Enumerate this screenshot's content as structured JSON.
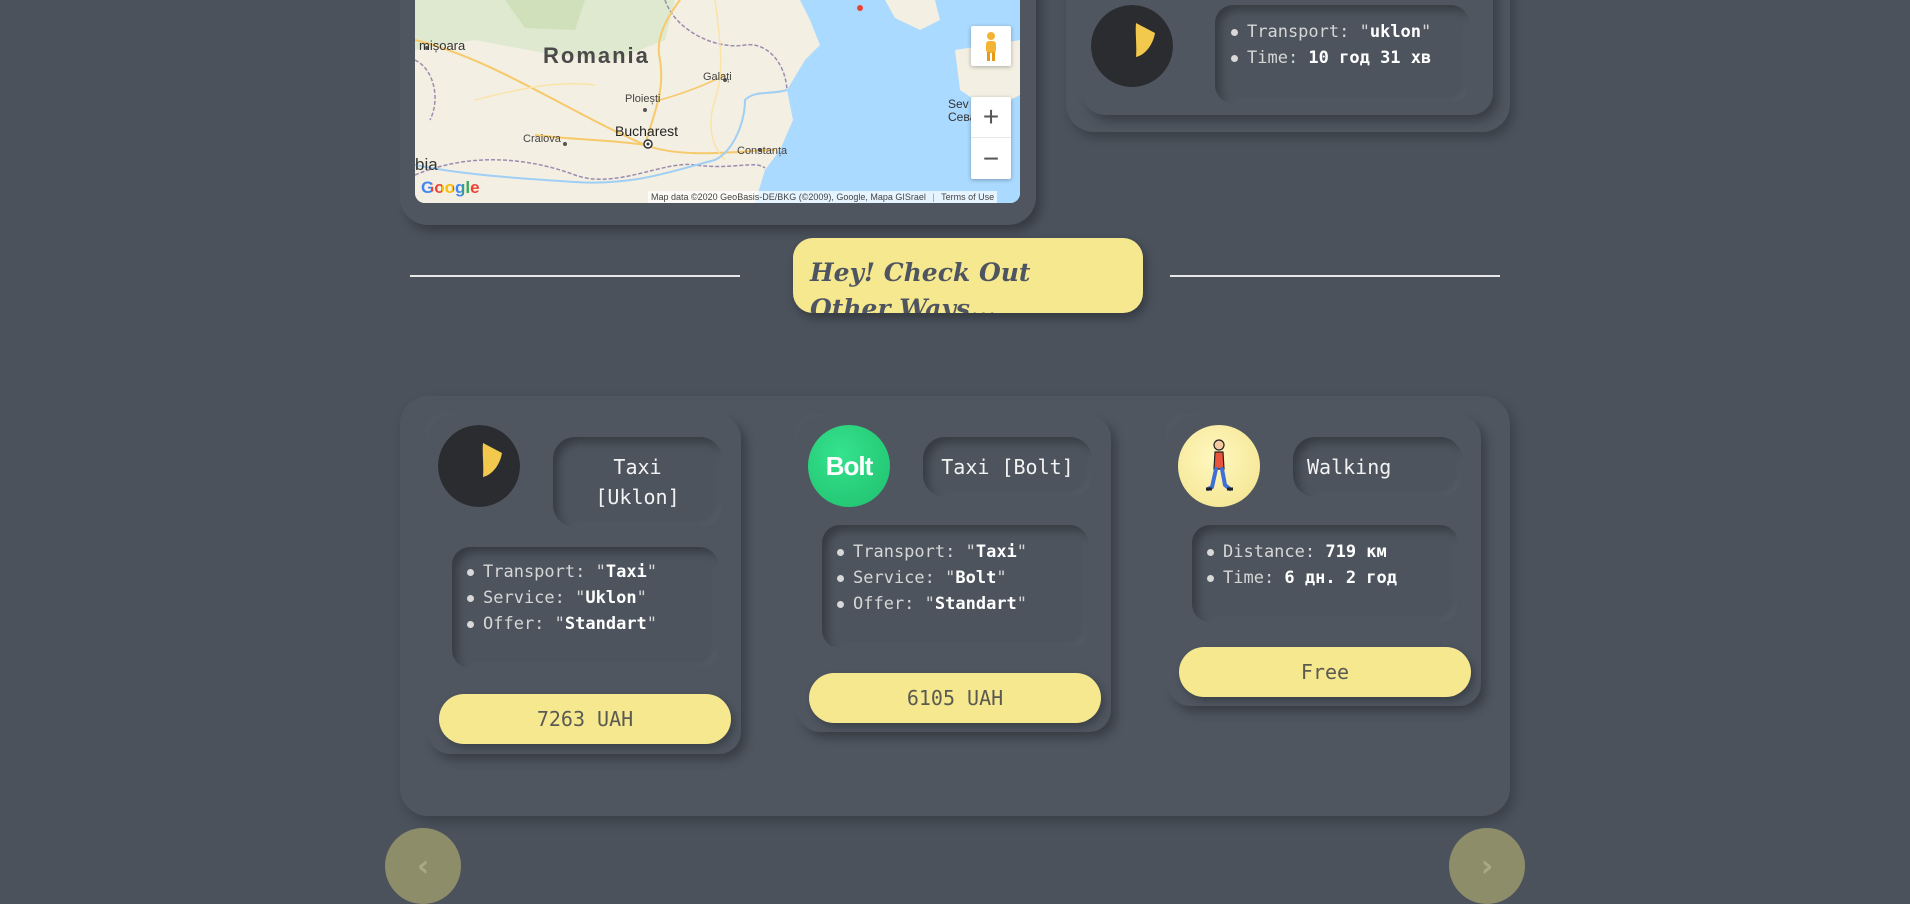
{
  "map": {
    "labels": {
      "romania": "Romania",
      "timisoara": "mișoara",
      "bucharest": "Bucharest",
      "craiova": "Craiova",
      "ploiesti": "Ploiești",
      "galati": "Galați",
      "constanta": "Constanța",
      "sevastopol_1": "Sev",
      "sevastopol_2": "Севас",
      "bia": "bia"
    },
    "google_logo": "Google",
    "attribution": "Map data ©2020 GeoBasis-DE/BKG (©2009), Google, Mapa GISrael",
    "terms": "Terms of Use",
    "zoom_in": "+",
    "zoom_out": "−"
  },
  "top_card": {
    "transport_label": "Transport: ",
    "transport_value": "uklon",
    "time_label": "Time: ",
    "time_value": "10 год 31 хв"
  },
  "divider": {
    "heading": "Hey! Check Out Other Ways..."
  },
  "options": [
    {
      "title": "Taxi [Uklon]",
      "transport_label": "Transport: ",
      "transport_value": "Taxi",
      "service_label": "Service: ",
      "service_value": "Uklon",
      "offer_label": "Offer: ",
      "offer_value": "Standart",
      "price": "7263 UAH"
    },
    {
      "title": "Taxi [Bolt]",
      "logo_text": "Bolt",
      "transport_label": "Transport: ",
      "transport_value": "Taxi",
      "service_label": "Service: ",
      "service_value": "Bolt",
      "offer_label": "Offer: ",
      "offer_value": "Standart",
      "price": "6105 UAH"
    },
    {
      "title": "Walking",
      "distance_label": "Distance: ",
      "distance_value": "719 км",
      "time_label": "Time: ",
      "time_value": "6 дн. 2 год",
      "price": "Free"
    }
  ],
  "nav": {
    "prev": "‹",
    "next": "›"
  },
  "colors": {
    "background": "#4b525c",
    "accent_yellow": "#f6e88f",
    "bolt_green": "#2bd17e",
    "uklon_dark": "#2a2c30",
    "uklon_yellow": "#f2c94c"
  },
  "icons": {
    "uklon": "uklon-logo-icon",
    "bolt": "bolt-logo-icon",
    "walking": "walking-person-icon",
    "pegman": "pegman-icon",
    "prev": "chevron-left-icon",
    "next": "chevron-right-icon"
  }
}
